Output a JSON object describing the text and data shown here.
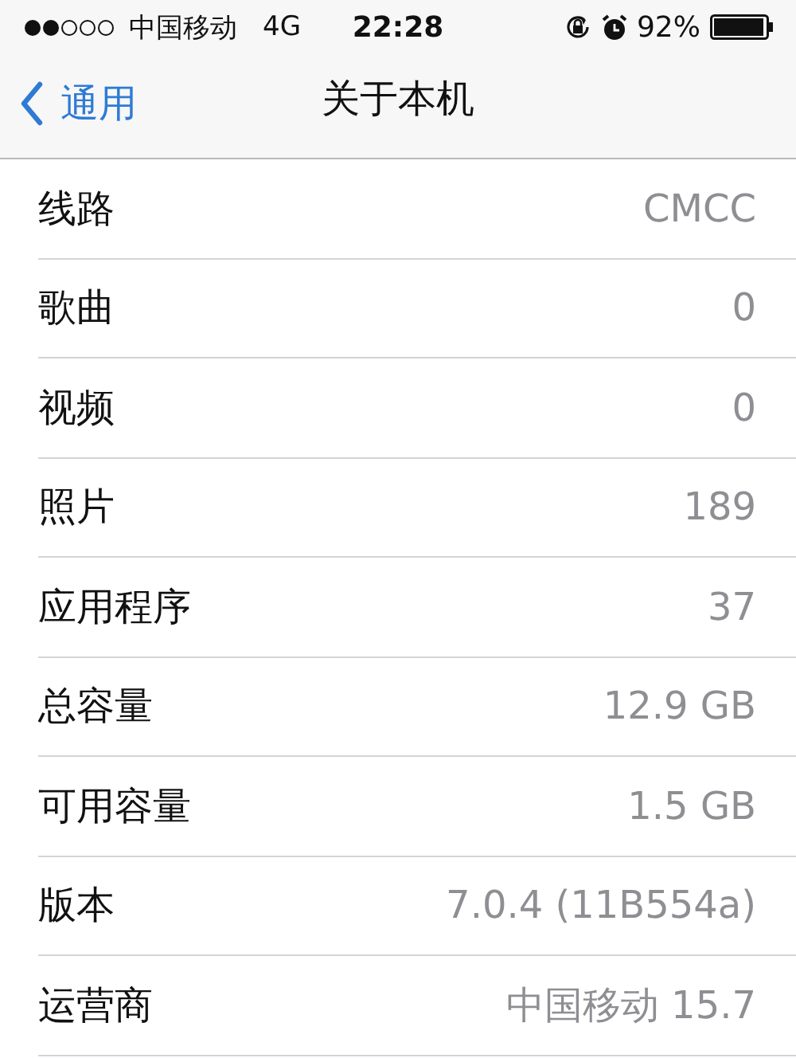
{
  "status_bar": {
    "carrier": "中国移动",
    "network": "4G",
    "time": "22:28",
    "battery": "92%"
  },
  "nav_bar": {
    "back": "通用",
    "title": "关于本机"
  },
  "rows": [
    {
      "label": "线路",
      "value": "CMCC"
    },
    {
      "label": "歌曲",
      "value": "0"
    },
    {
      "label": "视频",
      "value": "0"
    },
    {
      "label": "照片",
      "value": "189"
    },
    {
      "label": "应用程序",
      "value": "37"
    },
    {
      "label": "总容量",
      "value": "12.9 GB"
    },
    {
      "label": "可用容量",
      "value": "1.5 GB"
    },
    {
      "label": "版本",
      "value": "7.0.4 (11B554a)"
    },
    {
      "label": "运营商",
      "value": "中国移动 15.7"
    }
  ]
}
